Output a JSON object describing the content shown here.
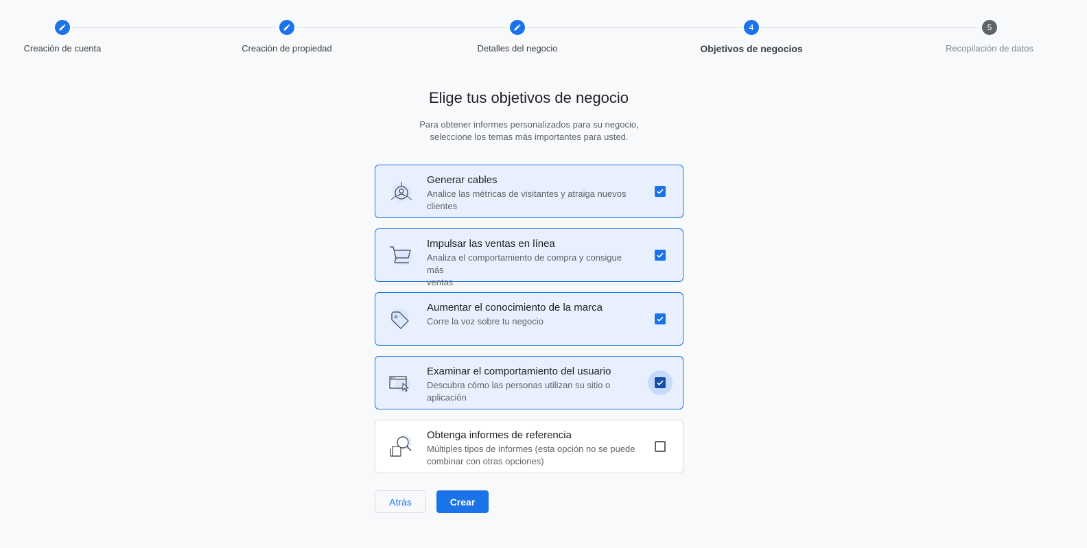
{
  "stepper": {
    "steps": [
      {
        "number": "",
        "label": "Creación de cuenta",
        "state": "done"
      },
      {
        "number": "",
        "label": "Creación de propiedad",
        "state": "done"
      },
      {
        "number": "",
        "label": "Detalles del negocio",
        "state": "done"
      },
      {
        "number": "4",
        "label": "Objetivos de negocios",
        "state": "active"
      },
      {
        "number": "5",
        "label": "Recopilación de datos",
        "state": "pending"
      }
    ]
  },
  "main": {
    "title": "Elige tus objetivos de negocio",
    "subtitle_line1": "Para obtener informes personalizados para su negocio,",
    "subtitle_line2": "seleccione los temas más importantes para usted."
  },
  "goals": [
    {
      "title": "Generar cables",
      "desc_line1": "Analice las métricas de visitantes y atraiga nuevos",
      "desc_line2": "clientes",
      "checked": true,
      "icon": "user-network-icon"
    },
    {
      "title": "Impulsar las ventas en línea",
      "desc_line1": "Analiza el comportamiento de compra y consigue más",
      "desc_line2": "ventas",
      "checked": true,
      "icon": "shopping-cart-icon"
    },
    {
      "title": "Aumentar el conocimiento de la marca",
      "desc_line1": "Corre la voz sobre tu negocio",
      "desc_line2": "",
      "checked": true,
      "icon": "tag-icon"
    },
    {
      "title": "Examinar el comportamiento del usuario",
      "desc_line1": "Descubra cómo las personas utilizan su sitio o",
      "desc_line2": "aplicación",
      "checked": true,
      "icon": "browser-cursor-icon"
    },
    {
      "title": "Obtenga informes de referencia",
      "desc_line1": "Múltiples tipos de informes (esta opción no se puede",
      "desc_line2": "combinar con otras opciones)",
      "checked": false,
      "icon": "magnifier-document-icon"
    }
  ],
  "buttons": {
    "back_label": "Atrás",
    "create_label": "Crear"
  },
  "colors": {
    "accent": "#1a73e8",
    "card_selected_bg": "#e8f0fe",
    "pending_step": "#5f6368"
  }
}
